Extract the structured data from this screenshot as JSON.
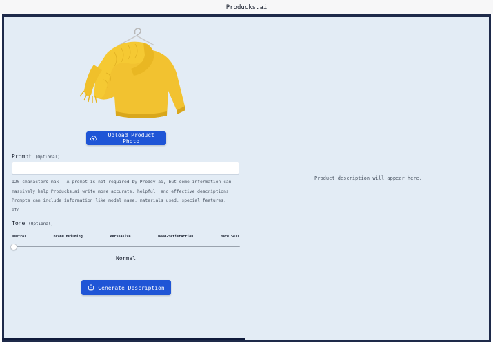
{
  "window": {
    "title": "Producks.ai"
  },
  "upload": {
    "label": "Upload Product Photo"
  },
  "prompt": {
    "label": "Prompt",
    "optional": "(Optional)",
    "value": "",
    "help_lines": [
      "120 characters max - A prompt is not required by Proddy.ai, but some information can",
      "massively help Producks.ai write more accurate, helpful, and effective descriptions.",
      "Prompts can include information like model name, materials used, special features,",
      "etc."
    ]
  },
  "tone": {
    "label": "Tone",
    "optional": "(Optional)",
    "options": [
      "Neutral",
      "Brand Building",
      "Persuasive",
      "Need-Satisfaction",
      "Hard Sell"
    ],
    "selected": "Normal",
    "slider_level": 0
  },
  "generate": {
    "label": "Generate Description"
  },
  "output": {
    "placeholder": "Product description will appear here."
  },
  "colors": {
    "accent": "#1f55d6",
    "panel_bg": "#e3ecf5",
    "frame_border": "#1e2a4a",
    "product_yellow": "#f2c230"
  },
  "icons": {
    "upload": "cloud-upload-icon",
    "generate": "robot-icon"
  }
}
